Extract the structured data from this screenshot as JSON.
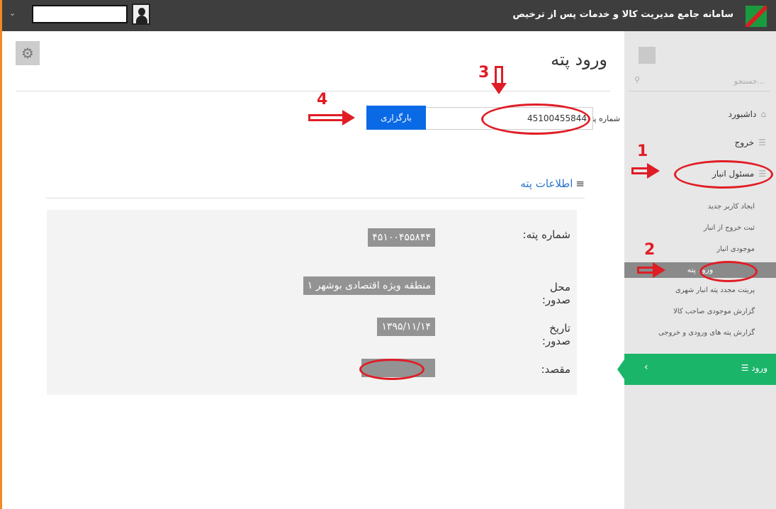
{
  "header": {
    "app_title": "سامانه جامع مدیریت کالا و خدمات پس از ترخیص",
    "user_name": "",
    "colors": {
      "bar": "#3e3e3e",
      "logo_green": "#1a9a3f",
      "logo_red": "#d42020"
    }
  },
  "sidebar": {
    "search_placeholder": "جستجو...",
    "items": [
      {
        "label": "داشبورد",
        "icon": "home-icon"
      },
      {
        "label": "خروج",
        "icon": "list-icon"
      },
      {
        "label": "مسئول انبار",
        "icon": "list-icon"
      }
    ],
    "subitems": [
      {
        "label": "ایجاد کاربر جدید"
      },
      {
        "label": "ثبت خروج از انبار"
      },
      {
        "label": "موجودی انبار"
      },
      {
        "label": "ورود پته",
        "active": true
      },
      {
        "label": "پرینت مجدد پته انبار شهری"
      },
      {
        "label": "گزارش موجودی صاحب کالا"
      },
      {
        "label": "گزارش پته های ورودی و خروجی"
      }
    ],
    "footer_label": "ورود",
    "footer_color": "#1bb56a"
  },
  "main": {
    "page_title": "ورود پته",
    "shipment_label": "شماره پته",
    "shipment_value": "45100455844",
    "load_button": "بارگزاری",
    "section_title": "اطلاعات پته",
    "fields": [
      {
        "label": "شماره پته:",
        "value": "۴۵۱۰۰۴۵۵۸۴۴"
      },
      {
        "label": "محل صدور:",
        "value": "منطقه ویژه اقتصادی بوشهر ۱"
      },
      {
        "label": "تاریخ صدور:",
        "value": "۱۳۹۵/۱۱/۱۴"
      },
      {
        "label": "مقصد:",
        "value": ""
      }
    ]
  },
  "annotations": {
    "numbers": [
      "1",
      "2",
      "3",
      "4"
    ],
    "color": "#e01d25"
  }
}
